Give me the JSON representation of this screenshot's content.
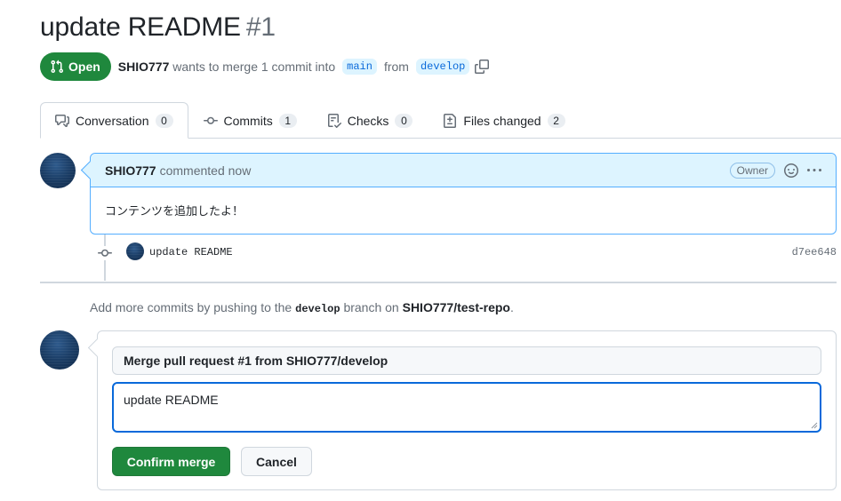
{
  "pr": {
    "title": "update README",
    "number": "#1",
    "state": "Open",
    "author": "SHIO777",
    "merge_text": "wants to merge 1 commit into",
    "base_branch": "main",
    "from_text": "from",
    "head_branch": "develop"
  },
  "tabs": [
    {
      "label": "Conversation",
      "count": "0",
      "icon": "comment-discussion-icon",
      "selected": true
    },
    {
      "label": "Commits",
      "count": "1",
      "icon": "git-commit-icon",
      "selected": false
    },
    {
      "label": "Checks",
      "count": "0",
      "icon": "checklist-icon",
      "selected": false
    },
    {
      "label": "Files changed",
      "count": "2",
      "icon": "file-diff-icon",
      "selected": false
    }
  ],
  "comment": {
    "author": "SHIO777",
    "action": "commented now",
    "role_label": "Owner",
    "body": "コンテンツを追加したよ！"
  },
  "commit": {
    "message": "update README",
    "sha": "d7ee648"
  },
  "push_hint": {
    "prefix": "Add more commits by pushing to the",
    "branch": "develop",
    "middle": "branch on",
    "repo": "SHIO777/test-repo",
    "suffix": "."
  },
  "merge": {
    "title_value": "Merge pull request #1 from SHIO777/develop",
    "message_value": "update README",
    "confirm_label": "Confirm merge",
    "cancel_label": "Cancel"
  },
  "colors": {
    "open_green": "#1f883d",
    "accent_blue": "#0969da",
    "comment_header_bg": "#ddf4ff",
    "border": "#d0d7de"
  }
}
